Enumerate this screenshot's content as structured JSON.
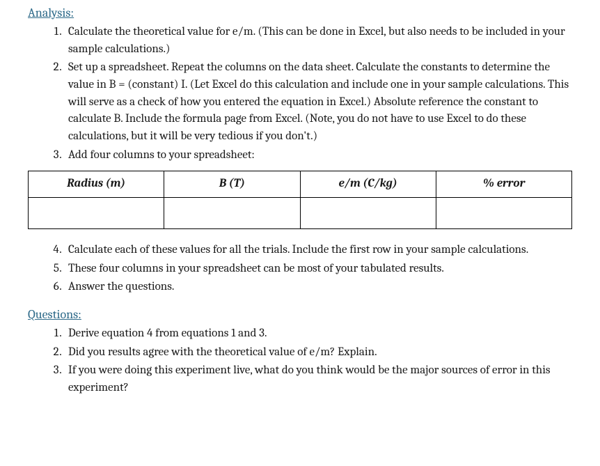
{
  "analysis": {
    "heading": "Analysis:",
    "items": [
      "Calculate the theoretical value for e/m. (This can be done in Excel, but also needs to be included in your sample calculations.)",
      "Set up a spreadsheet. Repeat the columns on the data sheet. Calculate the constants to determine the value in B = (constant) I. (Let Excel do this calculation and include one in your sample calculations. This will serve as a check of how you entered the equation in Excel.) Absolute reference the constant to calculate B. Include the formula page from Excel. (Note, you do not have to use Excel to do these calculations, but it will be very tedious if you don't.)",
      "Add four columns to your spreadsheet:"
    ],
    "table_headers": [
      "Radius (m)",
      "B (T)",
      "e/m (C/kg)",
      "% error"
    ],
    "items_after": [
      "Calculate each of these values for all the trials. Include the first row in your sample calculations.",
      "These four columns in your spreadsheet can be most of your tabulated results.",
      "Answer the questions."
    ]
  },
  "questions": {
    "heading": "Questions:",
    "items": [
      "Derive equation 4 from equations 1 and 3.",
      "Did you results agree with the theoretical value of e/m? Explain.",
      "If you were doing this experiment live, what do you think would be the major sources of error in this experiment?"
    ]
  }
}
